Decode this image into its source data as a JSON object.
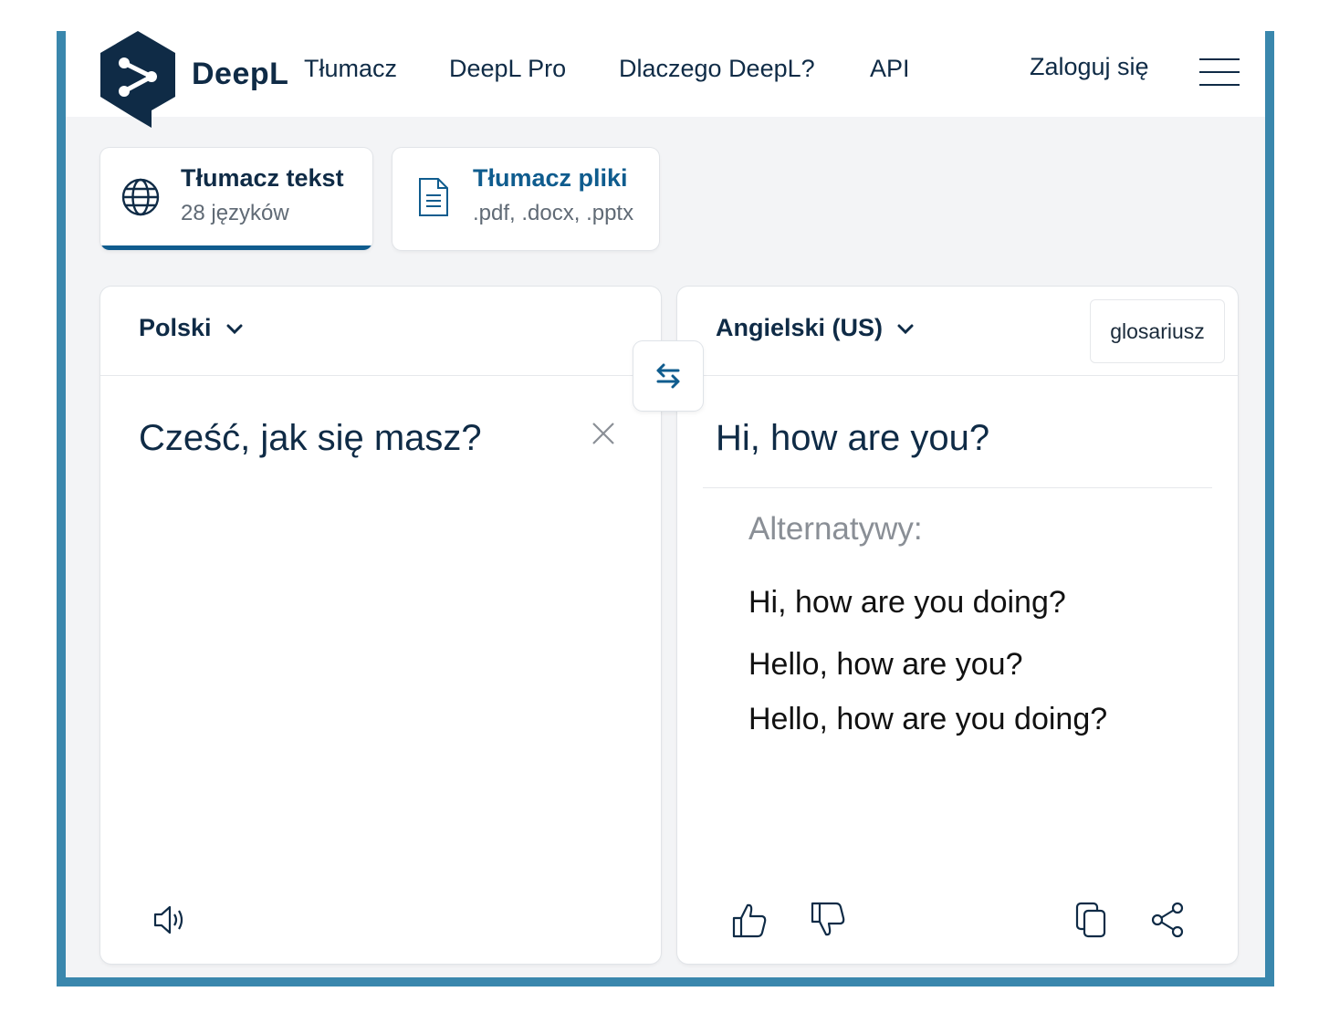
{
  "header": {
    "brand": "DeepL",
    "nav": [
      "Tłumacz",
      "DeepL Pro",
      "Dlaczego DeepL?",
      "API"
    ],
    "login": "Zaloguj się"
  },
  "modes": {
    "text": {
      "title": "Tłumacz tekst",
      "subtitle": "28 języków"
    },
    "files": {
      "title": "Tłumacz pliki",
      "subtitle": ".pdf, .docx, .pptx"
    }
  },
  "source": {
    "language": "Polski",
    "text": "Cześć, jak się masz?"
  },
  "target": {
    "language": "Angielski (US)",
    "glossary": "glosariusz",
    "text": "Hi, how are you?",
    "alternatives_label": "Alternatywy:",
    "alternatives": [
      "Hi, how are you doing?",
      "Hello, how are you?",
      "Hello, how are you doing?"
    ]
  },
  "colors": {
    "accent": "#0f5c8e",
    "brand_dark": "#0f2b46",
    "frame": "#3a87ad"
  },
  "icons": [
    "globe-icon",
    "document-icon",
    "chevron-down-icon",
    "swap-icon",
    "close-icon",
    "speaker-icon",
    "thumbs-up-icon",
    "thumbs-down-icon",
    "copy-icon",
    "share-icon",
    "menu-icon"
  ]
}
